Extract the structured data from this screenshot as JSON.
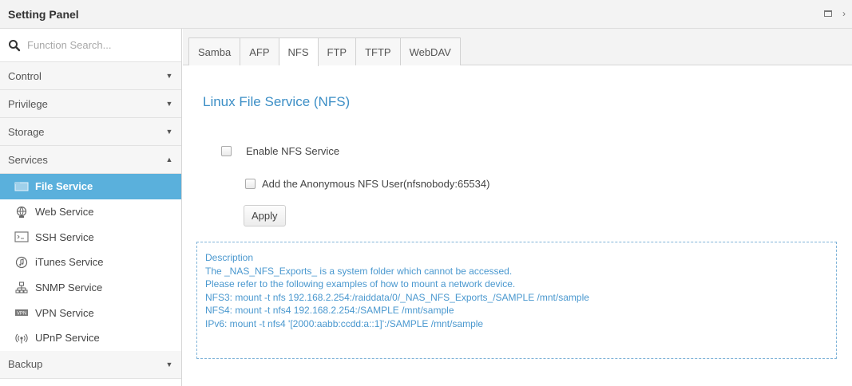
{
  "window": {
    "title": "Setting Panel"
  },
  "sidebar": {
    "search_placeholder": "Function Search...",
    "categories_top": [
      {
        "label": "Control",
        "arrow": "▼"
      },
      {
        "label": "Privilege",
        "arrow": "▼"
      },
      {
        "label": "Storage",
        "arrow": "▼"
      },
      {
        "label": "Services",
        "arrow": "▲"
      }
    ],
    "services_items": [
      {
        "label": "File Service",
        "icon": "file-service-icon",
        "active": true
      },
      {
        "label": "Web Service",
        "icon": "web-service-icon",
        "active": false
      },
      {
        "label": "SSH Service",
        "icon": "ssh-service-icon",
        "active": false
      },
      {
        "label": "iTunes Service",
        "icon": "itunes-service-icon",
        "active": false
      },
      {
        "label": "SNMP Service",
        "icon": "snmp-service-icon",
        "active": false
      },
      {
        "label": "VPN Service",
        "icon": "vpn-service-icon",
        "active": false
      },
      {
        "label": "UPnP Service",
        "icon": "upnp-service-icon",
        "active": false
      }
    ],
    "categories_bottom": [
      {
        "label": "Backup",
        "arrow": "▼"
      }
    ]
  },
  "tabs": [
    {
      "label": "Samba",
      "active": false
    },
    {
      "label": "AFP",
      "active": false
    },
    {
      "label": "NFS",
      "active": true
    },
    {
      "label": "FTP",
      "active": false
    },
    {
      "label": "TFTP",
      "active": false
    },
    {
      "label": "WebDAV",
      "active": false
    }
  ],
  "content": {
    "heading": "Linux File Service (NFS)",
    "enable_label": "Enable NFS Service",
    "enable_checked": false,
    "anonymous_label": "Add the Anonymous NFS User(nfsnobody:65534)",
    "anonymous_checked": false,
    "apply_label": "Apply",
    "description": {
      "title": "Description",
      "lines": [
        "The _NAS_NFS_Exports_ is a system folder which cannot be accessed.",
        "Please refer to the following examples of how to mount a network device.",
        "NFS3: mount -t nfs 192.168.2.254:/raiddata/0/_NAS_NFS_Exports_/SAMPLE /mnt/sample",
        "NFS4: mount -t nfs4 192.168.2.254:/SAMPLE /mnt/sample",
        "IPv6: mount -t nfs4 '[2000:aabb:ccdd:a::1]':/SAMPLE /mnt/sample"
      ]
    }
  },
  "colors": {
    "accent": "#5ab0dc",
    "heading": "#3d8fc6",
    "description_text": "#4a98cf",
    "description_border": "#7fb3d8"
  }
}
